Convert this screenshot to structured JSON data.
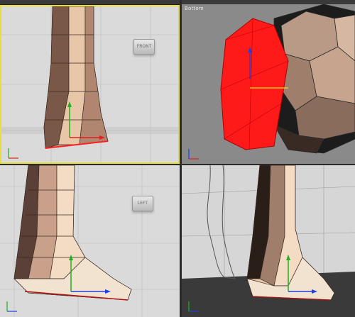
{
  "viewports": {
    "front": {
      "cube_label": "FRONT"
    },
    "top_right": {
      "title": "Bottom"
    },
    "left": {
      "cube_label": "LEFT"
    },
    "perspective": {}
  },
  "colors": {
    "active_border": "#e8df3a",
    "selected_mesh": "#ff1a1a",
    "axis_x": "#e02020",
    "axis_y": "#20b020",
    "axis_z": "#2040e0"
  }
}
